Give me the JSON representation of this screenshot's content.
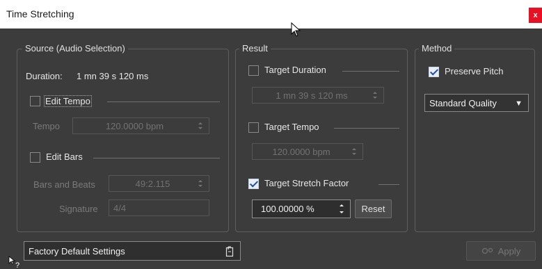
{
  "window": {
    "title": "Time Stretching",
    "close_label": "x"
  },
  "source": {
    "legend": "Source (Audio Selection)",
    "duration_label": "Duration:",
    "duration_value": "1 mn 39 s 120 ms",
    "edit_tempo": {
      "label": "Edit Tempo",
      "checked": false
    },
    "tempo": {
      "label": "Tempo",
      "value": "120.0000 bpm"
    },
    "edit_bars": {
      "label": "Edit Bars",
      "checked": false
    },
    "bars_beats": {
      "label": "Bars and Beats",
      "value": "49:2.115"
    },
    "signature": {
      "label": "Signature",
      "value": "4/4"
    }
  },
  "result": {
    "legend": "Result",
    "target_duration": {
      "label": "Target Duration",
      "checked": false,
      "value": "1 mn 39 s 120 ms"
    },
    "target_tempo": {
      "label": "Target Tempo",
      "checked": false,
      "value": "120.0000 bpm"
    },
    "target_stretch": {
      "label": "Target Stretch Factor",
      "checked": true,
      "value": "100.00000 %"
    },
    "reset_label": "Reset"
  },
  "method": {
    "legend": "Method",
    "preserve_pitch": {
      "label": "Preserve Pitch",
      "checked": true
    },
    "quality": "Standard Quality"
  },
  "footer": {
    "preset": "Factory Default Settings",
    "apply_label": "Apply"
  },
  "icons": [
    "close-icon",
    "mouse-cursor-icon",
    "dropdown-arrow-icon",
    "spin-arrows-icon",
    "preset-menu-icon",
    "gears-icon",
    "help-cursor-icon",
    "checkmark-icon"
  ],
  "colors": {
    "close": "#e81123",
    "check_fill": "#e8eef9",
    "check_mark": "#1d4fa0"
  }
}
